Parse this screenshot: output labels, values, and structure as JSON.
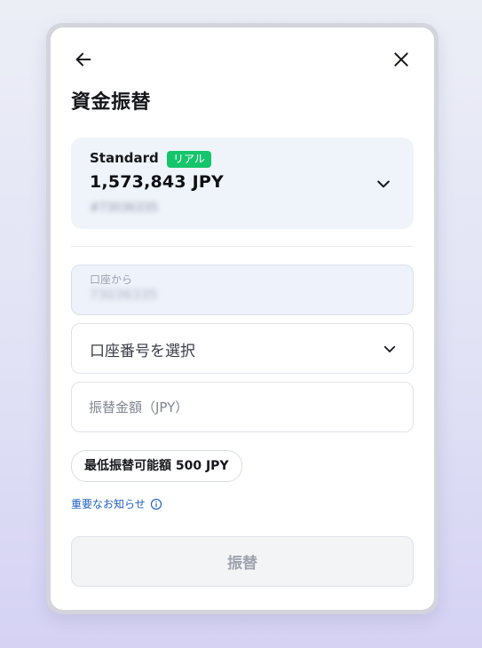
{
  "header": {
    "back_icon": "arrow-left-icon",
    "close_icon": "close-icon",
    "title": "資金振替"
  },
  "account_card": {
    "type": "Standard",
    "badge": "リアル",
    "badge_color": "#15c46b",
    "balance": "1,573,843 JPY",
    "account_number": "#73036335",
    "chevron_icon": "chevron-down-icon"
  },
  "from_field": {
    "label": "口座から",
    "value": "73036335"
  },
  "to_account_select": {
    "placeholder": "口座番号を選択",
    "chevron_icon": "chevron-down-icon"
  },
  "amount_field": {
    "placeholder": "振替金額（JPY）",
    "value": ""
  },
  "min_transfer": {
    "label": "最低振替可能額 500 JPY"
  },
  "notice": {
    "label": "重要なお知らせ",
    "icon": "info-icon",
    "color": "#1f5fbf"
  },
  "submit": {
    "label": "振替",
    "state": "disabled"
  }
}
